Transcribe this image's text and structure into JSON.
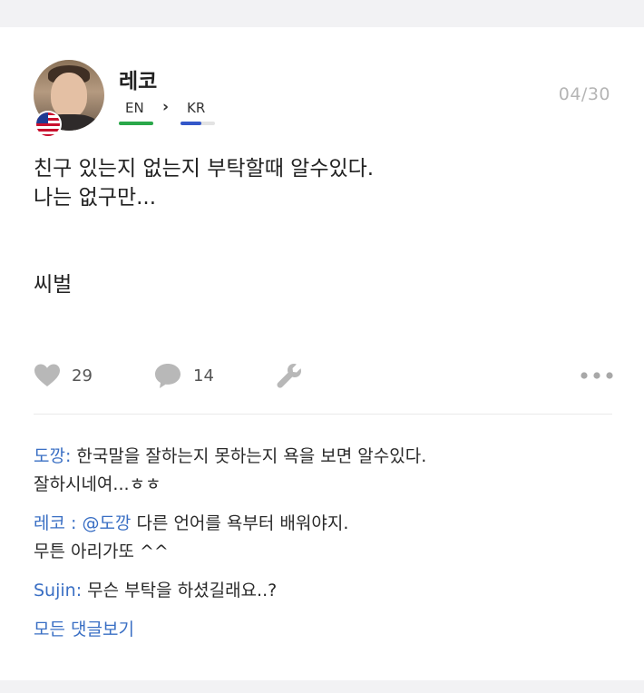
{
  "post": {
    "author": "레코",
    "date": "04/30",
    "native_language": "EN",
    "learning_language": "KR",
    "native_level": 1.0,
    "learning_level": 0.6,
    "body_lines": [
      "친구 있는지 없는지 부탁할때 알수있다.",
      "나는 없구만...",
      "씨벌"
    ],
    "likes": "29",
    "comments_count": "14"
  },
  "comments": [
    {
      "author": "도깡:",
      "text_line1": " 한국말을 잘하는지 못하는지 욕을 보면 알수있다.",
      "text_line2": "잘하시네여...ㅎㅎ"
    },
    {
      "author": "레코 : @도깡",
      "text_line1": " 다른 언어를 욕부터 배워야지.",
      "text_line2": "무튼 아리가또 ^^"
    },
    {
      "author": "Sujin:",
      "text_line1": " 무슨 부탁을 하셨길래요..?"
    }
  ],
  "view_all_comments": "모든 댓글보기",
  "icons": {
    "like": "heart-icon",
    "comment": "speech-bubble-icon",
    "correct": "wrench-icon",
    "more": "more-dots-icon",
    "flag": "us-flag-icon",
    "direction": "chevron-right-icon"
  },
  "colors": {
    "native_bar": "#2aa84a",
    "learning_bar": "#3357c9",
    "link": "#3a6fc4",
    "muted": "#b5b5b5"
  }
}
